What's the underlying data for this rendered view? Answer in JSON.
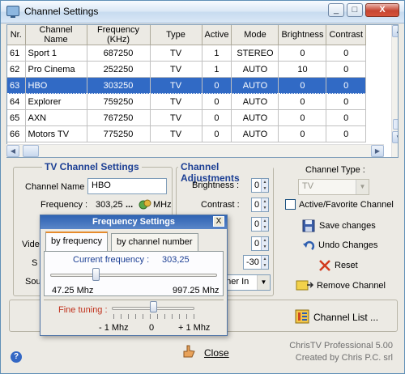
{
  "window": {
    "title": "Channel Settings",
    "min_label": "_",
    "max_label": "□",
    "close_label": "X"
  },
  "grid": {
    "columns": [
      "Nr.",
      "Channel Name",
      "Frequency (KHz)",
      "Type",
      "Active",
      "Mode",
      "Brightness",
      "Contrast"
    ],
    "rows": [
      [
        "61",
        "Sport 1",
        "687250",
        "TV",
        "1",
        "STEREO",
        "0",
        "0"
      ],
      [
        "62",
        "Pro Cinema",
        "252250",
        "TV",
        "1",
        "AUTO",
        "10",
        "0"
      ],
      [
        "63",
        "HBO",
        "303250",
        "TV",
        "0",
        "AUTO",
        "0",
        "0"
      ],
      [
        "64",
        "Explorer",
        "759250",
        "TV",
        "0",
        "AUTO",
        "0",
        "0"
      ],
      [
        "65",
        "AXN",
        "767250",
        "TV",
        "0",
        "AUTO",
        "0",
        "0"
      ],
      [
        "66",
        "Motors TV",
        "775250",
        "TV",
        "0",
        "AUTO",
        "0",
        "0"
      ]
    ],
    "selected_row": 2
  },
  "tv_settings": {
    "title": "TV Channel Settings",
    "channel_name_label": "Channel Name :",
    "channel_name_value": "HBO",
    "frequency_label": "Frequency :",
    "frequency_value": "303,25",
    "frequency_unit": "MHz",
    "ellipsis": "...",
    "video_label_partial": "Vide",
    "s_label_partial": "S",
    "sou_label_partial": "Sou"
  },
  "adjustments": {
    "title": "Channel Adjustments",
    "brightness_label": "Brightness :",
    "brightness_value": "0",
    "contrast_label": "Contrast :",
    "contrast_value": "0",
    "row3_value": "0",
    "row4_value": "0",
    "row5_value": "-30",
    "tuner_value": "uner In"
  },
  "right_panel": {
    "channel_type_label": "Channel Type :",
    "channel_type_value": "TV",
    "favorite_label": "Active/Favorite Channel",
    "save_label": "Save changes",
    "undo_label": "Undo Changes",
    "reset_label": "Reset",
    "remove_label": "Remove Channel",
    "channel_list_label": "Channel List ...",
    "close_label": "Close"
  },
  "freq_dialog": {
    "title": "Frequency Settings",
    "close_label": "X",
    "tab1": "by frequency",
    "tab2": "by channel number",
    "current_label": "Current frequency :",
    "current_value": "303,25",
    "min_label": "47.25 Mhz",
    "max_label": "997.25 Mhz",
    "fine_label": "Fine tuning :",
    "fine_min": "- 1 Mhz",
    "fine_mid": "0",
    "fine_max": "+ 1 Mhz",
    "frequency_position": 0.27,
    "fine_position": 0.5
  },
  "footer": {
    "product": "ChrisTV Professional 5.00",
    "company": "Created by Chris P.C. srl",
    "help_icon": "?"
  },
  "colors": {
    "selection": "#316ac5",
    "group_title": "#1c3f94",
    "dialog_title": "#2e63b3"
  }
}
